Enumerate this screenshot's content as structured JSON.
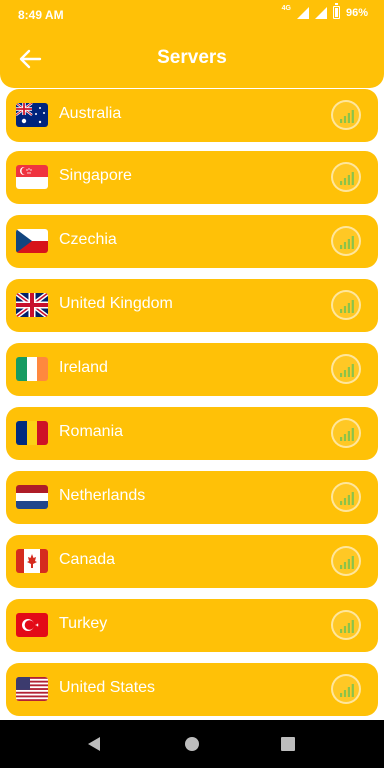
{
  "status_bar": {
    "time": "8:49 AM",
    "network": "4G",
    "battery": "96%"
  },
  "header": {
    "title": "Servers",
    "back_icon": "arrow-back-icon"
  },
  "servers": [
    {
      "name": "Australia",
      "flag": "flag-australia-icon"
    },
    {
      "name": "Singapore",
      "flag": "flag-singapore-icon"
    },
    {
      "name": "Czechia",
      "flag": "flag-czechia-icon"
    },
    {
      "name": "United Kingdom",
      "flag": "flag-united-kingdom-icon"
    },
    {
      "name": "Ireland",
      "flag": "flag-ireland-icon"
    },
    {
      "name": "Romania",
      "flag": "flag-romania-icon"
    },
    {
      "name": "Netherlands",
      "flag": "flag-netherlands-icon"
    },
    {
      "name": "Canada",
      "flag": "flag-canada-icon"
    },
    {
      "name": "Turkey",
      "flag": "flag-turkey-icon"
    },
    {
      "name": "United States",
      "flag": "flag-united-states-icon"
    }
  ],
  "colors": {
    "accent": "#FFC107",
    "signal": "#8BC34A",
    "text": "#FFFFFF"
  }
}
